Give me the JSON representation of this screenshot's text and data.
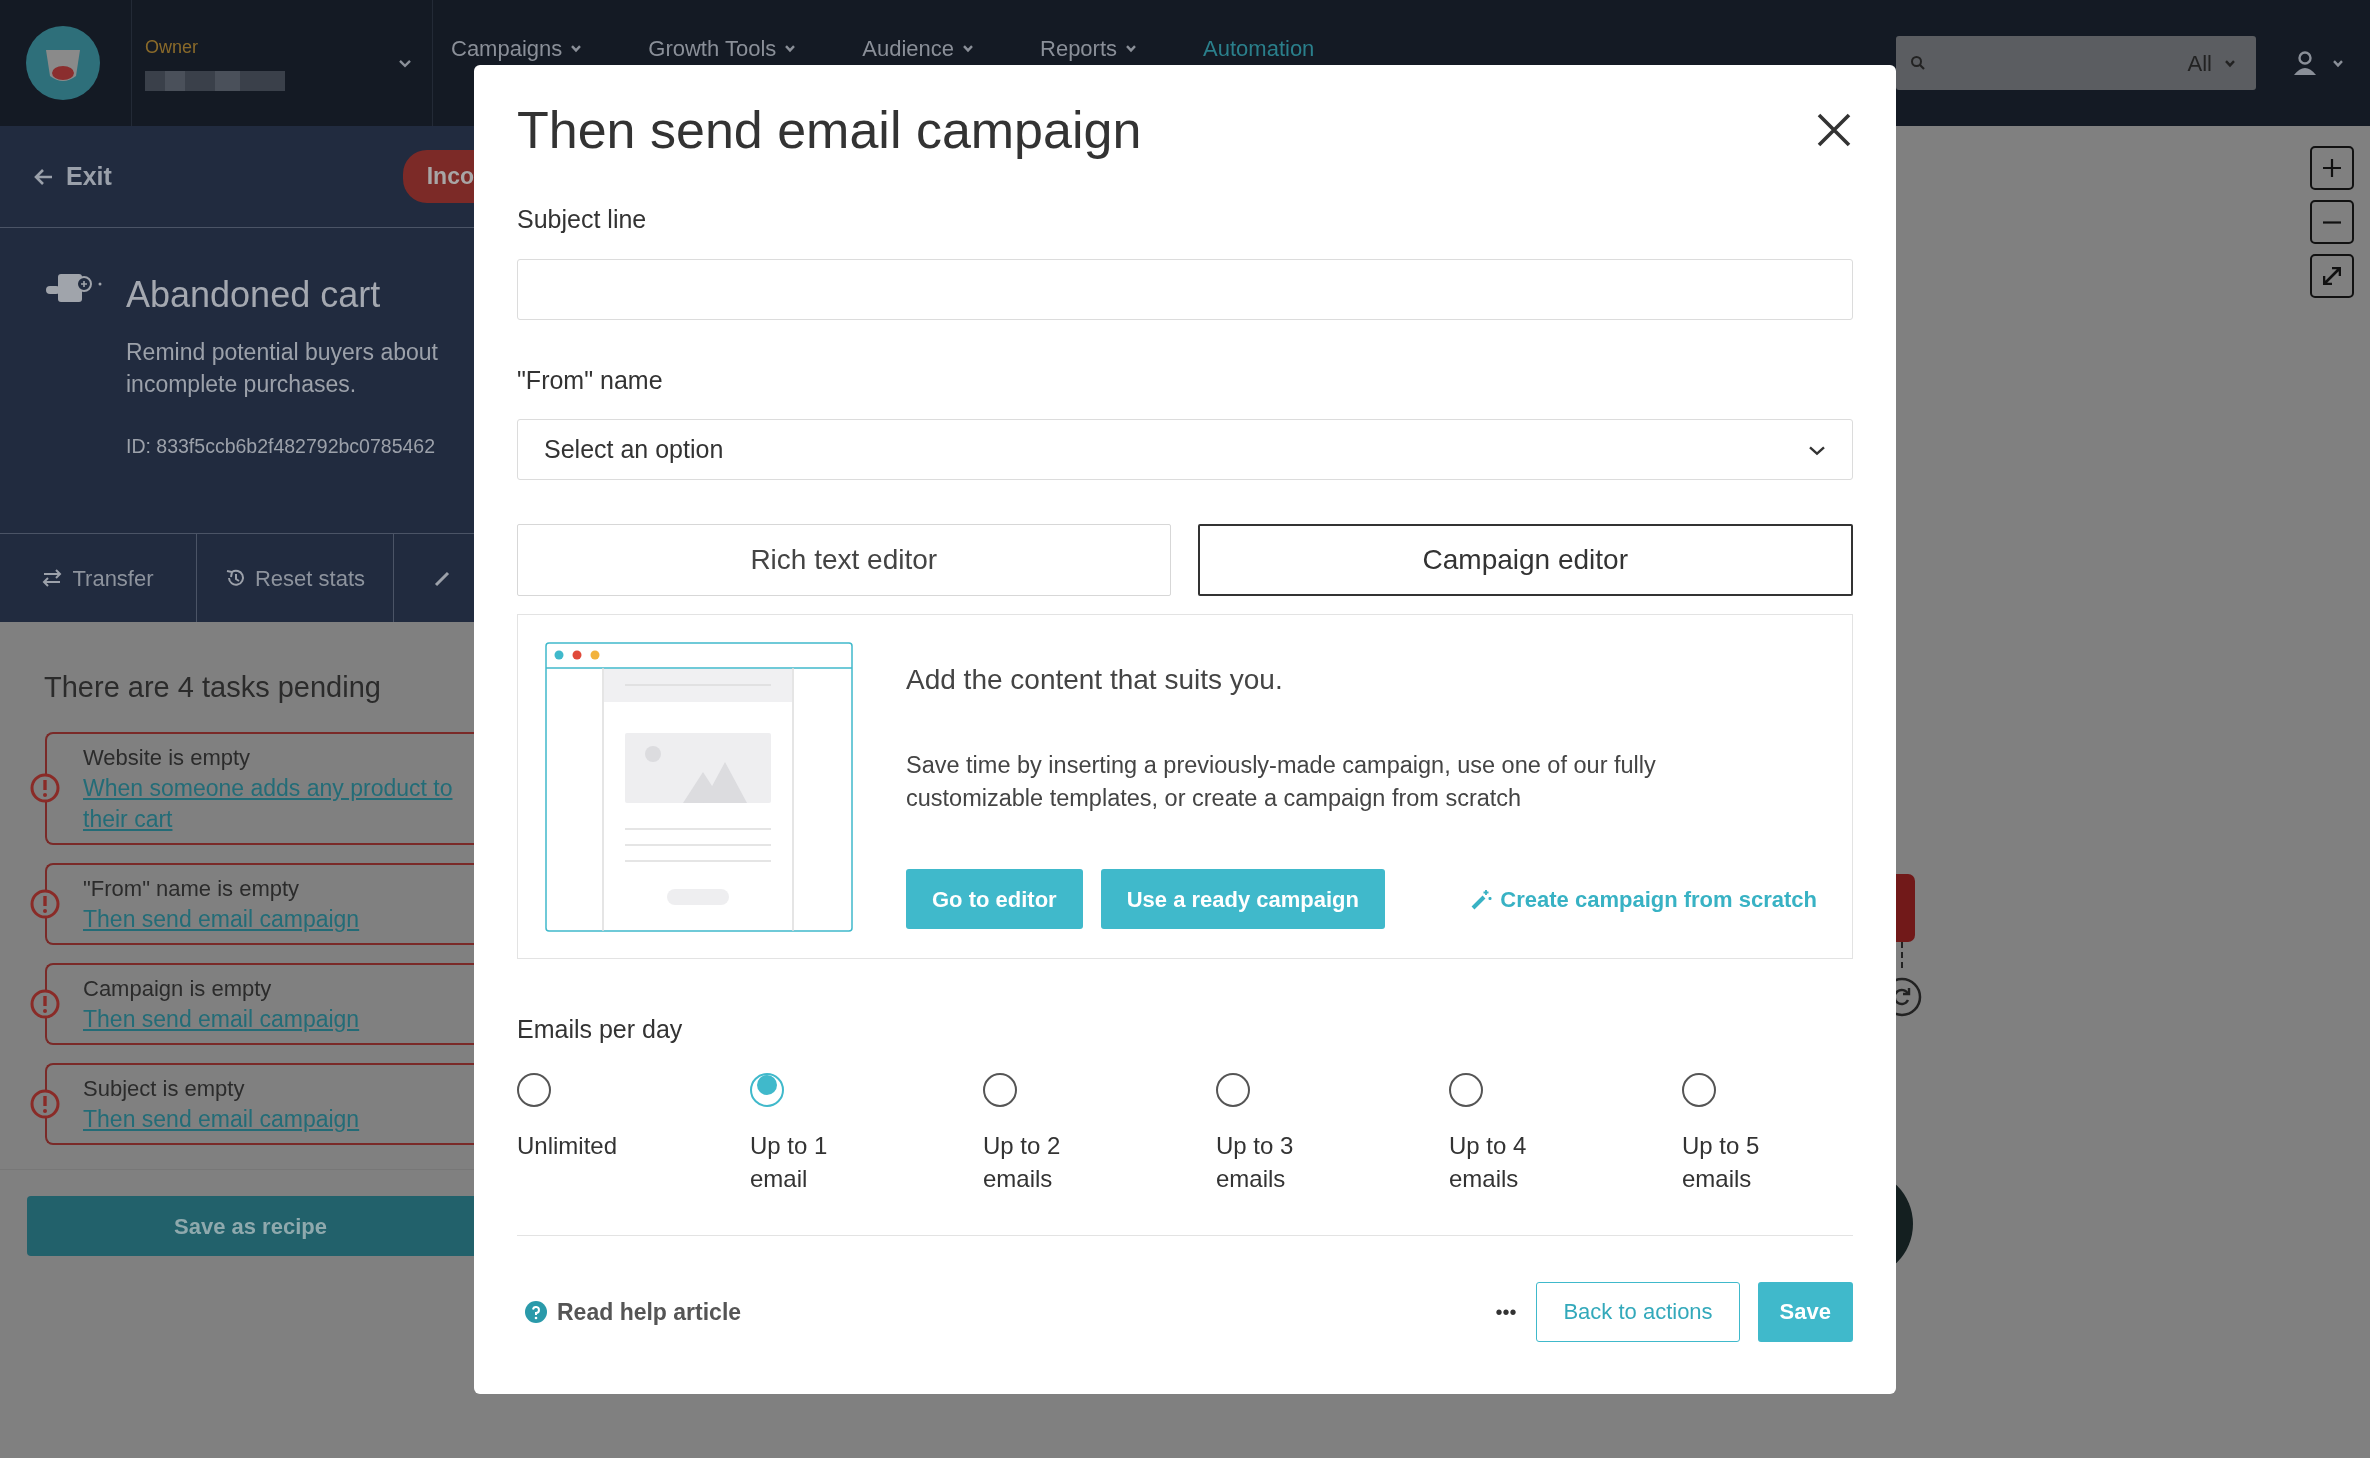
{
  "navbar": {
    "role_label": "Owner",
    "nav_items": [
      {
        "label": "Campaigns",
        "selected": false,
        "dropdown": true
      },
      {
        "label": "Growth Tools",
        "selected": false,
        "dropdown": true
      },
      {
        "label": "Audience",
        "selected": false,
        "dropdown": true
      },
      {
        "label": "Reports",
        "selected": false,
        "dropdown": true
      },
      {
        "label": "Automation",
        "selected": true,
        "dropdown": false
      }
    ],
    "search": {
      "scope": "All"
    }
  },
  "sidebar": {
    "exit": "Exit",
    "status_badge": "Inco",
    "title": "Abandoned cart",
    "description_lines": [
      "Remind potential buyers about",
      "incomplete purchases."
    ],
    "id_text": "ID: 833f5ccb6b2f482792bc0785462",
    "actions": [
      {
        "kind": "transfer",
        "label": "Transfer"
      },
      {
        "kind": "reset",
        "label": "Reset stats"
      }
    ],
    "tasks_heading": "There are 4 tasks pending",
    "tasks": [
      {
        "title": "Website is empty",
        "link": "When someone adds any product to their cart"
      },
      {
        "title": "\"From\" name is empty",
        "link": "Then send email campaign"
      },
      {
        "title": "Campaign is empty",
        "link": "Then send email campaign"
      },
      {
        "title": "Subject is empty",
        "link": "Then send email campaign"
      }
    ],
    "save_button": "Save as recipe"
  },
  "modal": {
    "title": "Then send email campaign",
    "subject_label": "Subject line",
    "from_label": "\"From\" name",
    "from_select": "Select an option",
    "editor_tabs": [
      {
        "label": "Rich text editor",
        "selected": false
      },
      {
        "label": "Campaign editor",
        "selected": true
      }
    ],
    "content": {
      "heading": "Add the content that suits you.",
      "text": "Save time by inserting a previously-made campaign, use one of our fully customizable templates, or create a campaign from scratch",
      "buttons": [
        "Go to editor",
        "Use a ready campaign"
      ],
      "link": "Create campaign from scratch"
    },
    "emails_label": "Emails per day",
    "emails_options": [
      {
        "label": "Unlimited",
        "selected": false
      },
      {
        "label": "Up to 1 email",
        "selected": true
      },
      {
        "label": "Up to 2 emails",
        "selected": false
      },
      {
        "label": "Up to 3 emails",
        "selected": false
      },
      {
        "label": "Up to 4 emails",
        "selected": false
      },
      {
        "label": "Up to 5 emails",
        "selected": false
      }
    ],
    "help_link": "Read help article",
    "more": "•••",
    "back_button": "Back to actions",
    "save_button": "Save"
  }
}
